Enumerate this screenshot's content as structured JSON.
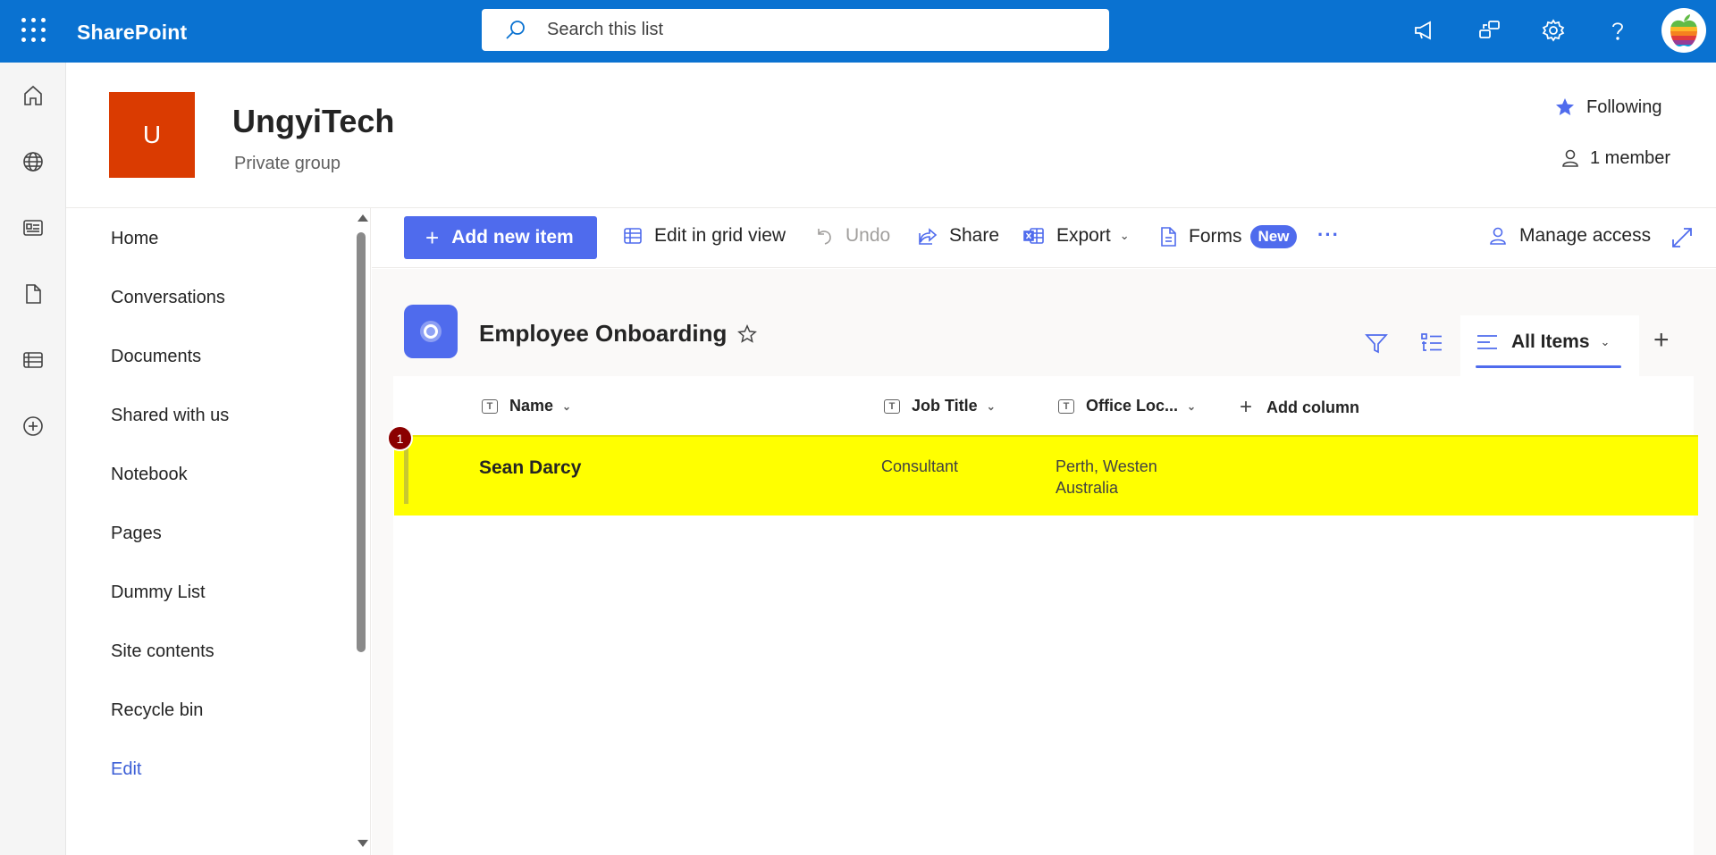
{
  "suite_bar": {
    "brand": "SharePoint",
    "search_placeholder": "Search this list"
  },
  "site": {
    "logo_letter": "U",
    "title": "UngyiTech",
    "subtitle": "Private group",
    "following_label": "Following",
    "members_label": "1 member"
  },
  "nav": {
    "items": [
      "Home",
      "Conversations",
      "Documents",
      "Shared with us",
      "Notebook",
      "Pages",
      "Dummy List",
      "Site contents",
      "Recycle bin"
    ],
    "edit_label": "Edit"
  },
  "command_bar": {
    "add_new_item": "Add new item",
    "edit_grid": "Edit in grid view",
    "undo": "Undo",
    "share": "Share",
    "export": "Export",
    "forms": "Forms",
    "forms_badge": "New",
    "manage_access": "Manage access"
  },
  "list": {
    "title": "Employee Onboarding",
    "view_name": "All Items",
    "columns": [
      "Name",
      "Job Title",
      "Office Loc..."
    ],
    "add_column": "Add column",
    "rows": [
      {
        "marker": "1",
        "name": "Sean Darcy",
        "job_title": "Consultant",
        "office_line1": "Perth, Westen",
        "office_line2": "Australia"
      }
    ]
  },
  "colors": {
    "suite_bar": "#0a72d1",
    "accent": "#4f6bed",
    "site_logo": "#da3b01",
    "row_highlight": "#ffff00",
    "marker": "#8b0000"
  }
}
